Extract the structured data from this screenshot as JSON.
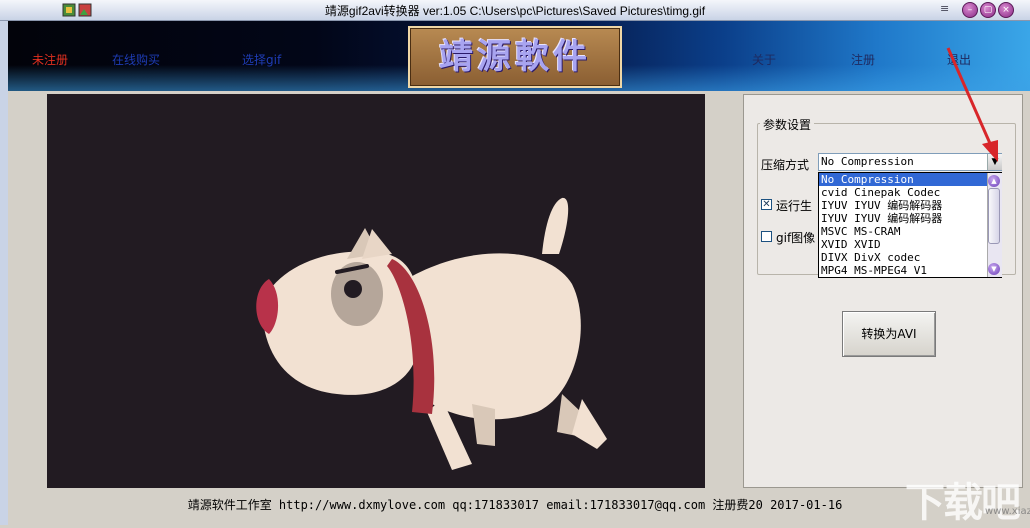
{
  "window": {
    "title": "靖源gif2avi转换器 ver:1.05 C:\\Users\\pc\\Pictures\\Saved Pictures\\timg.gif",
    "menu_glyph": "≡"
  },
  "banner": {
    "nav_left": [
      "未注册",
      "在线购买",
      "选择gif"
    ],
    "logo_text": "靖源軟件",
    "nav_right": [
      "关于",
      "注册",
      "退出"
    ]
  },
  "params": {
    "group_title": "参数设置",
    "compress_label": "压缩方式",
    "compress_value": "No Compression",
    "options": [
      "No Compression",
      "cvid Cinepak Codec",
      "IYUV IYUV 编码解码器",
      "IYUV IYUV 编码解码器",
      "MSVC MS-CRAM",
      "XVID XVID",
      "DIVX DivX codec",
      "MPG4 MS-MPEG4 V1"
    ],
    "check1_label": "运行生",
    "check1_checked": true,
    "check2_label": "gif图像",
    "check2_checked": false,
    "convert_button": "转换为AVI"
  },
  "footer": "靖源软件工作室 http://www.dxmylove.com qq:171833017 email:171833017@qq.com 注册费20 2017-01-16",
  "watermark": "下载吧",
  "watermark_small": "www.xiazaiba.com",
  "colors": {
    "accent_red": "#e03020",
    "nav_blue": "#1e3cb4",
    "selection": "#3168d5"
  }
}
